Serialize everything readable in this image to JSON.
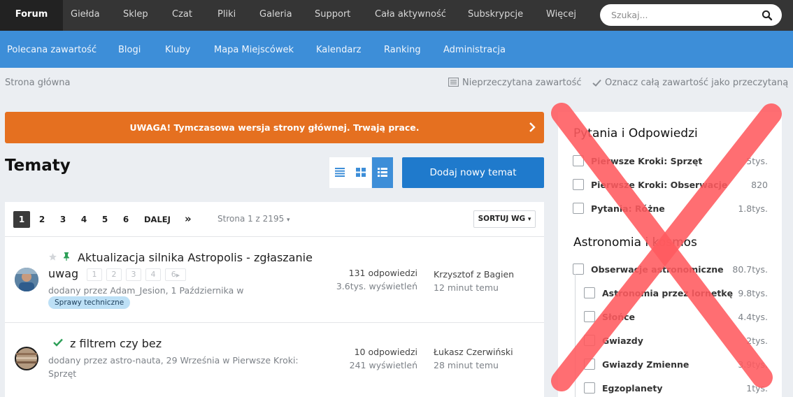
{
  "nav": {
    "items": [
      "Forum",
      "Giełda",
      "Sklep",
      "Czat",
      "Pliki",
      "Galeria",
      "Support",
      "Cała aktywność",
      "Subskrypcje",
      "Więcej"
    ],
    "search_placeholder": "Szukaj..."
  },
  "subnav": {
    "items": [
      "Polecana zawartość",
      "Blogi",
      "Kluby",
      "Mapa Miejscówek",
      "Kalendarz",
      "Ranking",
      "Administracja"
    ]
  },
  "breadcrumb": "Strona główna",
  "actions": {
    "unread": "Nieprzeczytana zawartość",
    "mark_read": "Oznacz całą zawartość jako przeczytaną"
  },
  "banner": {
    "text": "UWAGA! Tymczasowa wersja strony głównej. Trwają prace."
  },
  "topics": {
    "heading": "Tematy",
    "add_button": "Dodaj nowy temat",
    "pages": [
      "1",
      "2",
      "3",
      "4",
      "5",
      "6"
    ],
    "next_label": "DALEJ",
    "last_label": "»",
    "page_info": "Strona 1 z 2195",
    "sort_label": "SORTUJ WG",
    "rows": [
      {
        "title_line1": "Aktualizacja silnika Astropolis - zgłaszanie",
        "title_line2": "uwag",
        "mini_pages": [
          "1",
          "2",
          "3",
          "4",
          "6"
        ],
        "meta": "dodany przez Adam_Jesion, 1 Października w",
        "tag": "Sprawy techniczne",
        "replies": "131 odpowiedzi",
        "views": "3.6tys. wyświetleń",
        "last_user": "Krzysztof z Bagien",
        "last_time": "12 minut temu"
      },
      {
        "title_line1": "z filtrem czy bez",
        "meta_line1": "dodany przez astro-nauta, 29 Września w Pierwsze Kroki:",
        "meta_line2": "Sprzęt",
        "replies": "10 odpowiedzi",
        "views": "241 wyświetleń",
        "last_user": "Łukasz Czerwiński",
        "last_time": "28 minut temu"
      }
    ]
  },
  "sidebar": {
    "section1": {
      "title": "Pytania i Odpowiedzi",
      "forums": [
        {
          "name": "Pierwsze Kroki: Sprzęt",
          "count": "5tys."
        },
        {
          "name": "Pierwsze Kroki: Obserwacje",
          "count": "820"
        },
        {
          "name": "Pytania: Różne",
          "count": "1.8tys."
        }
      ]
    },
    "section2": {
      "title": "Astronomia i kosmos",
      "forums": [
        {
          "name": "Obserwacje astronomiczne",
          "count": "80.7tys."
        },
        {
          "name": "Astronomia przez lornetkę",
          "count": "9.8tys."
        },
        {
          "name": "Słońce",
          "count": "4.4tys."
        },
        {
          "name": "Gwiazdy",
          "count": "2tys."
        },
        {
          "name": "Gwiazdy Zmienne",
          "count": "3.9tys."
        },
        {
          "name": "Egzoplanety",
          "count": "1tys."
        }
      ]
    }
  },
  "colors": {
    "nav_bg": "#353535",
    "subnav_bg": "#3d8ed8",
    "banner_bg": "#e57020",
    "primary_button": "#1f7acc",
    "overlay_cross": "#ff5a5f"
  }
}
